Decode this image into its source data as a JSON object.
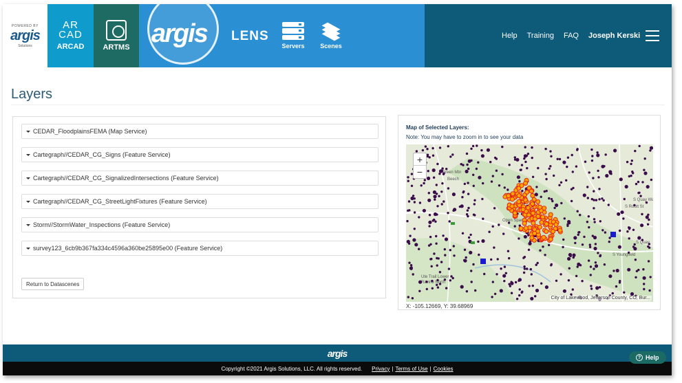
{
  "brand": {
    "powered": "POWERED BY",
    "name": "argis",
    "sub": "Solutions"
  },
  "apps": [
    {
      "mark": "AR\nCAD",
      "label": "ARCAD",
      "color": "#0f9ccc"
    },
    {
      "label": "ARTMS",
      "color": "#1d6b63"
    }
  ],
  "lens": {
    "logo": "argis",
    "title": "LENS",
    "servers_label": "Servers",
    "scenes_label": "Scenes",
    "color": "#2b8fd4"
  },
  "nav": {
    "help": "Help",
    "training": "Training",
    "faq": "FAQ",
    "user": "Joseph Kerski",
    "color": "#0e5a79"
  },
  "page": {
    "title": "Layers"
  },
  "layers": [
    "CEDAR_FloodplainsFEMA (Map Service)",
    "Cartegraph//CEDAR_CG_Signs (Feature Service)",
    "Cartegraph//CEDAR_CG_SignalizedIntersections (Feature Service)",
    "Cartegraph//CEDAR_CG_StreetLightFixtures (Feature Service)",
    "Storm//StormWater_Inspections (Feature Service)",
    "survey123_6cb9b367fa334c4596a360be25895e00 (Feature Service)"
  ],
  "return_button": "Return to Datascenes",
  "map": {
    "title": "Map of Selected Layers:",
    "note": "Note: You may have to zoom in to see your data",
    "zoom_in": "+",
    "zoom_out": "−",
    "attribution": "City of Lakewood, Jefferson County, CO, Bur...",
    "coordinates": "X: -105.12669, Y: 39.68969",
    "labels": [
      "Green Mtn",
      "Beech",
      "Open Space",
      "Ute Trail Lower",
      "Ravine North",
      "S Routt St",
      "S Quay Way",
      "S Quay",
      "S Youngfield"
    ],
    "point_color": "#3a0d4a",
    "highlight_color": "#ffa500",
    "highlight_stroke": "#e3231b"
  },
  "footer": {
    "logo": "argis",
    "copyright": "Copyright ©2021 Argis Solutions, LLC. All rights reserved.",
    "privacy": "Privacy",
    "terms": "Terms of Use",
    "cookies": "Cookies",
    "help": "Help",
    "help_glyph": "?"
  }
}
